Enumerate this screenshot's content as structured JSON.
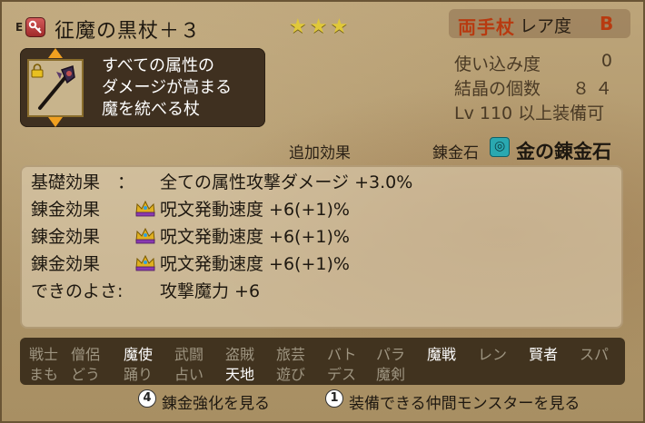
{
  "header": {
    "equip_mark": "E",
    "key_icon": "key-icon",
    "item_name": "征魔の黒杖＋３",
    "stars": "★★★",
    "weapon_type": "両手杖",
    "rarity_label": "レア度",
    "rarity_value": "B"
  },
  "description": {
    "lines": [
      "すべての属性の",
      "ダメージが高まる",
      "魔を統べる杖"
    ],
    "icons": [
      "staff-item-icon",
      "lock-icon"
    ]
  },
  "stats": [
    {
      "label": "使い込み度",
      "value": "0"
    },
    {
      "label": "結晶の個数",
      "value": "８４"
    },
    {
      "label": "Lv 110 以上装備可",
      "value": ""
    }
  ],
  "section": {
    "extra_label": "追加効果",
    "alchemy_label": "錬金石",
    "alchemy_icon_glyph": "◎",
    "alchemy_name": "金の錬金石"
  },
  "effects": [
    {
      "label": "基礎効果　：",
      "text": "全ての属性攻撃ダメージ +3.0%",
      "crown": false
    },
    {
      "label": "錬金効果",
      "text": "呪文発動速度 +6(+1)%",
      "crown": true
    },
    {
      "label": "錬金効果",
      "text": "呪文発動速度 +6(+1)%",
      "crown": true
    },
    {
      "label": "錬金効果",
      "text": "呪文発動速度 +6(+1)%",
      "crown": true
    },
    {
      "label": "できのよさ:",
      "text": "攻撃魔力 +6",
      "crown": false
    }
  ],
  "jobs_row1": [
    {
      "name": "戦士",
      "on": false
    },
    {
      "name": "僧侶",
      "on": false
    },
    {
      "name": "魔使",
      "on": true
    },
    {
      "name": "武闘",
      "on": false
    },
    {
      "name": "盗賊",
      "on": false
    },
    {
      "name": "旅芸",
      "on": false
    },
    {
      "name": "バト",
      "on": false
    },
    {
      "name": "パラ",
      "on": false
    },
    {
      "name": "魔戦",
      "on": true
    },
    {
      "name": "レン",
      "on": false
    },
    {
      "name": "賢者",
      "on": true
    },
    {
      "name": "スパ",
      "on": false
    }
  ],
  "jobs_row2": [
    {
      "name": "まも",
      "on": false
    },
    {
      "name": "どう",
      "on": false
    },
    {
      "name": "踊り",
      "on": false
    },
    {
      "name": "占い",
      "on": false
    },
    {
      "name": "天地",
      "on": true
    },
    {
      "name": "遊び",
      "on": false
    },
    {
      "name": "デス",
      "on": false
    },
    {
      "name": "魔剣",
      "on": false
    }
  ],
  "hints": [
    {
      "button": "4",
      "text": "錬金強化を見る"
    },
    {
      "button": "1",
      "text": "装備できる仲間モンスターを見る"
    }
  ],
  "colors": {
    "accent_red": "#b83a10",
    "star_gold": "#e0c83a",
    "panel_dark": "#3f3020"
  }
}
